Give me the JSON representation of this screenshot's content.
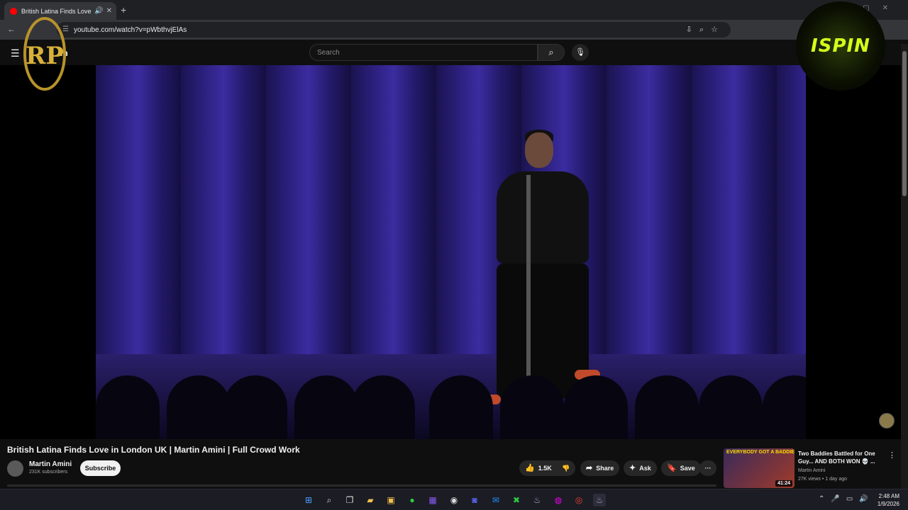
{
  "browser": {
    "tab_title": "British Latina Finds Love in",
    "url": "youtube.com/watch?v=pWbthvjElAs",
    "new_tab": "+",
    "close_tab": "✕",
    "back": "←",
    "menu": "⋮"
  },
  "youtube": {
    "logo_text": "m",
    "search_placeholder": "Search"
  },
  "overlay": {
    "left_logo_text": "RP",
    "globe_text": "ISPIN"
  },
  "video": {
    "title": "British Latina Finds Love in London UK | Martin Amini | Full Crowd Work",
    "channel": "Martin Amini",
    "subscribers": "231K subscribers",
    "subscribe_label": "Subscribe",
    "likes": "1.5K",
    "share_label": "Share",
    "ask_label": "Ask",
    "save_label": "Save",
    "more": "···"
  },
  "recommended": {
    "thumb_text": "EVERYBODY GOT A BADDIE",
    "duration": "41:24",
    "title": "Two Baddies Battled for One Guy... AND BOTH WON 💀 ...",
    "channel": "Martin Amini",
    "meta": "27K views • 1 day ago"
  },
  "taskbar": {
    "time": "2:48 AM",
    "date": "1/9/2026"
  },
  "colors": {
    "yt_bg": "#0f0f0f",
    "accent_red": "#ff0000",
    "globe_text": "#d4ff1a"
  }
}
